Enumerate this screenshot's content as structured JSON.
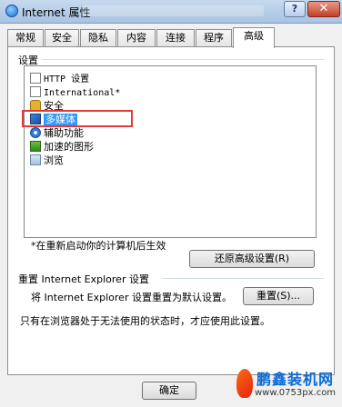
{
  "window": {
    "title": "Internet 属性",
    "help_label": "?",
    "close_label": "✕"
  },
  "tabs": [
    {
      "label": "常规",
      "active": false
    },
    {
      "label": "安全",
      "active": false
    },
    {
      "label": "隐私",
      "active": false
    },
    {
      "label": "内容",
      "active": false
    },
    {
      "label": "连接",
      "active": false
    },
    {
      "label": "程序",
      "active": false
    },
    {
      "label": "高级",
      "active": true
    }
  ],
  "settings": {
    "group_label": "设置",
    "items": [
      {
        "icon": "document-icon",
        "label": "HTTP 设置"
      },
      {
        "icon": "document-icon",
        "label": "International*"
      },
      {
        "icon": "lock-icon",
        "label": "安全"
      },
      {
        "icon": "multimedia-icon",
        "label": "多媒体",
        "selected": true
      },
      {
        "icon": "accessibility-icon",
        "label": "辅助功能"
      },
      {
        "icon": "graphics-icon",
        "label": "加速的图形"
      },
      {
        "icon": "browsing-icon",
        "label": "浏览"
      }
    ],
    "restart_note": "*在重新启动你的计算机后生效",
    "restore_button": "还原高级设置(R)"
  },
  "reset": {
    "group_label": "重置 Internet Explorer 设置",
    "description": "将 Internet Explorer 设置重置为默认设置。",
    "reset_button": "重置(S)...",
    "note": "只有在浏览器处于无法使用的状态时，才应使用此设置。"
  },
  "footer": {
    "ok_button": "确定"
  },
  "watermark": {
    "brand": "鹏鑫装机网",
    "url": "www.0753px.com"
  }
}
